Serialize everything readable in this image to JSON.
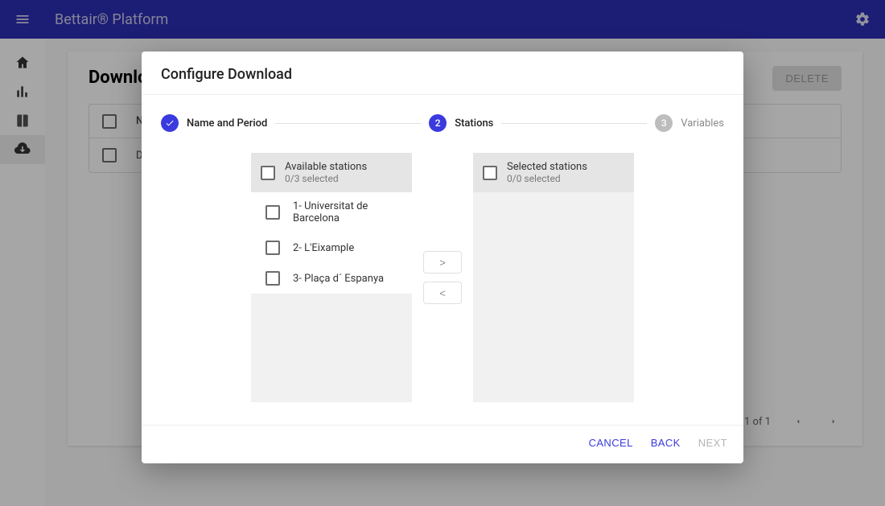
{
  "header": {
    "title": "Bettair® Platform"
  },
  "page": {
    "title": "Downloads",
    "delete_label": "DELETE",
    "table": {
      "header_name": "Name",
      "row0_name": "Download"
    },
    "pager": {
      "text": "1 of 1"
    }
  },
  "modal": {
    "title": "Configure Download",
    "steps": {
      "s1": {
        "label": "Name and Period"
      },
      "s2": {
        "num": "2",
        "label": "Stations"
      },
      "s3": {
        "num": "3",
        "label": "Variables"
      }
    },
    "available": {
      "title": "Available stations",
      "sub": "0/3 selected",
      "items": [
        "1- Universitat de Barcelona",
        "2- L'Eixample",
        "3- Plaça d´ Espanya"
      ]
    },
    "selected": {
      "title": "Selected stations",
      "sub": "0/0 selected"
    },
    "move_right": ">",
    "move_left": "<",
    "actions": {
      "cancel": "CANCEL",
      "back": "BACK",
      "next": "NEXT"
    }
  }
}
